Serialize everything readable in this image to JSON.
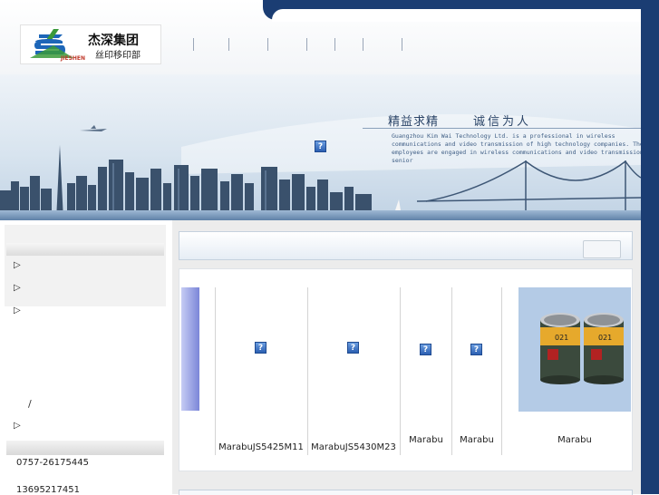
{
  "header": {
    "logo_title": "杰深集团",
    "logo_subtitle": "丝印移印部",
    "logo_brand": "JIESHEN",
    "nav_separators": [
      "|",
      "|",
      "|",
      "|",
      "|",
      "|",
      "|"
    ]
  },
  "banner": {
    "slogan_1": "精益求精",
    "slogan_2": "诚信为人",
    "english_text": "Guangzhou Kim Wai Technology Ltd. is a professional in wireless communications and video transmission of high technology companies. The employees are engaged in wireless communications and video transmission senior",
    "broken_image": "?"
  },
  "sidebar": {
    "menu_items": [
      "",
      "",
      ""
    ],
    "slash": "/",
    "contact": [
      "0757-26175445",
      "13695217451"
    ]
  },
  "main": {
    "products": [
      {
        "name": "",
        "image": "partial"
      },
      {
        "name": "MarabuJS5425M11",
        "image": "broken"
      },
      {
        "name": "MarabuJS5430M23",
        "image": "broken"
      },
      {
        "name": "Marabu",
        "image": "broken"
      },
      {
        "name": "Marabu",
        "image": "broken"
      },
      {
        "name": "Marabu",
        "image": "ink-cans"
      }
    ]
  },
  "colors": {
    "header_navy": "#1b3d73",
    "banner_sky": "#d8e4ef",
    "panel_bg": "#ececec"
  }
}
